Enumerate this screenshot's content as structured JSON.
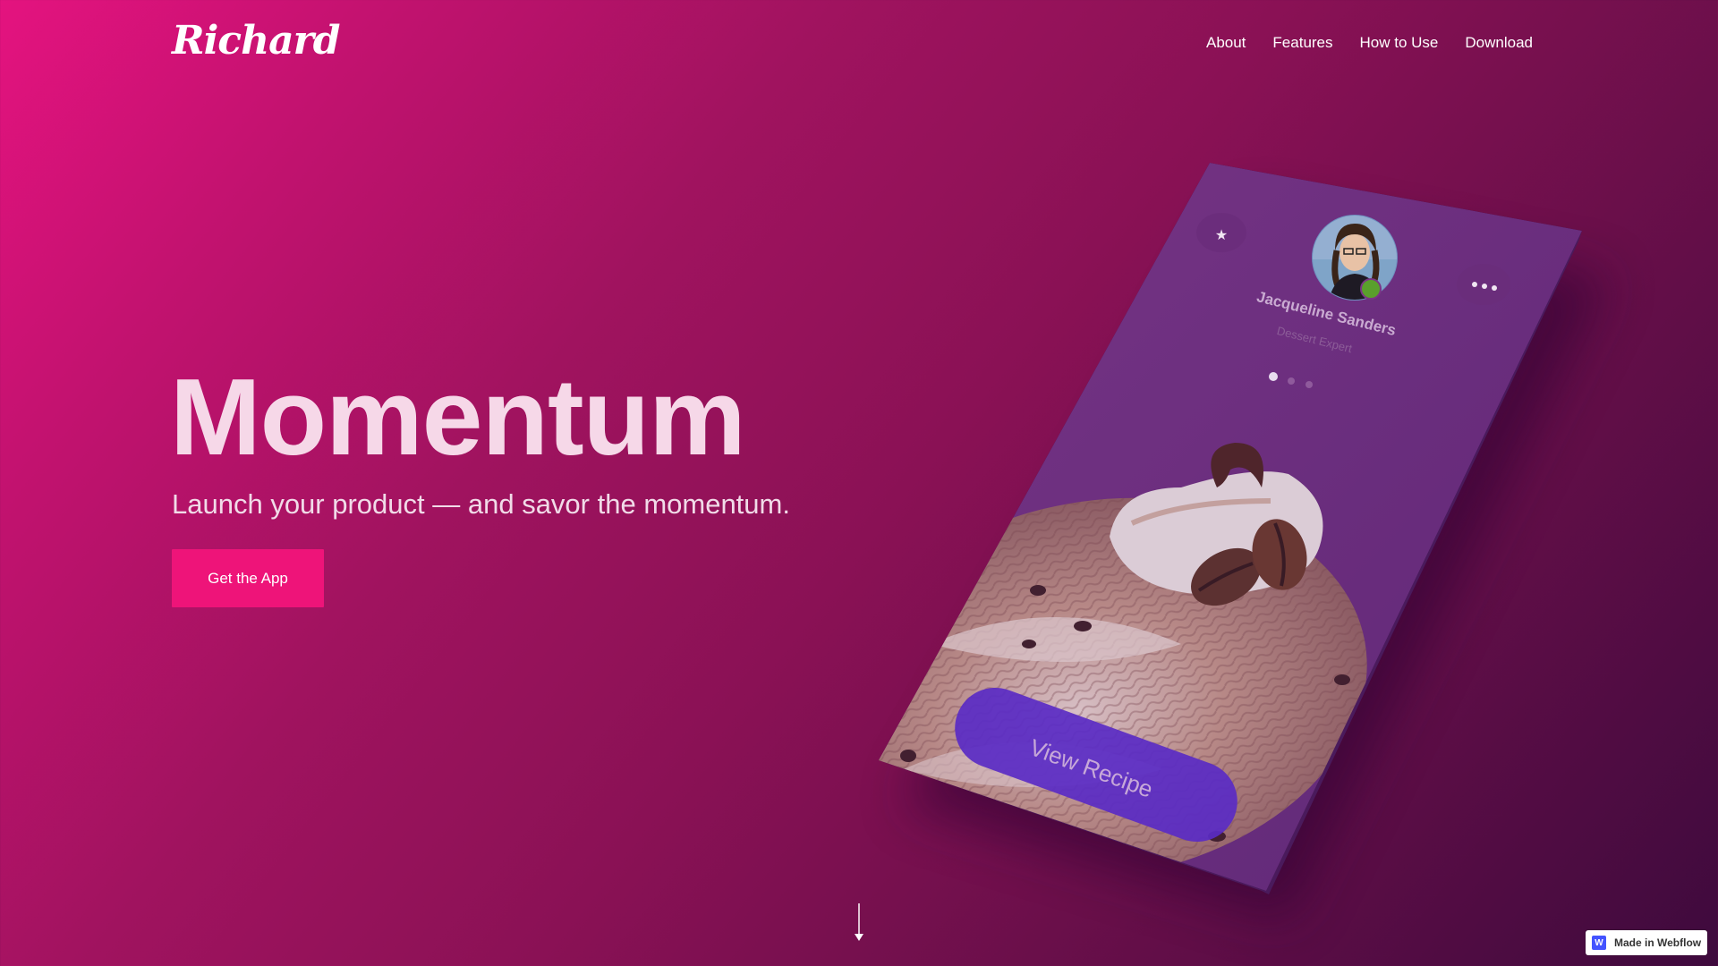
{
  "brand": {
    "logo_text": "Richard"
  },
  "nav": {
    "items": [
      {
        "label": "About"
      },
      {
        "label": "Features"
      },
      {
        "label": "How to Use"
      },
      {
        "label": "Download"
      }
    ]
  },
  "hero": {
    "title": "Momentum",
    "subtitle": "Launch your product — and savor the momentum.",
    "cta_label": "Get the App"
  },
  "phone": {
    "profile_name": "Jacqueline Sanders",
    "profile_role": "Dessert Expert",
    "button_label": "View Recipe",
    "status_color": "#5aa02c"
  },
  "icons": {
    "scroll": "arrow-down-icon",
    "star": "star-icon",
    "more": "more-dots-icon"
  },
  "badge": {
    "label": "Made in Webflow",
    "logo_letter": "W"
  },
  "colors": {
    "accent": "#ee1479",
    "phone_button": "#5a2bc4",
    "gradient_start": "#e4137f",
    "gradient_end": "#3e0a3d"
  }
}
